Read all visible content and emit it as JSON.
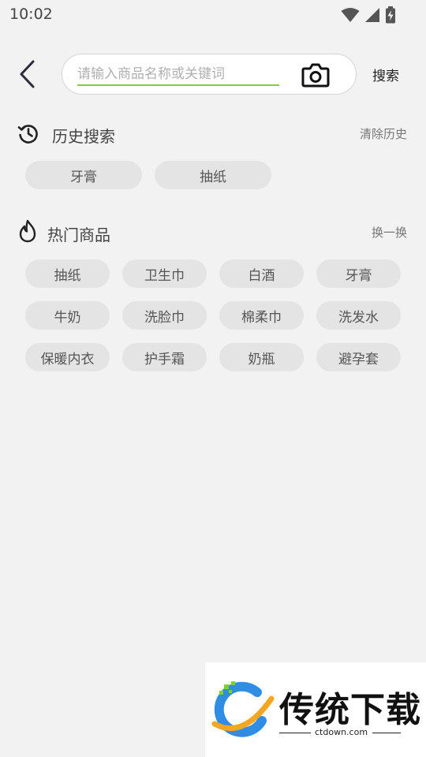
{
  "status_bar": {
    "time": "10:02",
    "icons": [
      "wifi-icon",
      "signal-icon",
      "battery-charging-icon"
    ]
  },
  "header": {
    "back_icon": "chevron-left-icon",
    "search_placeholder": "请输入商品名称或关键词",
    "search_value": "",
    "camera_icon": "camera-icon",
    "search_button": "搜索",
    "accent_color": "#8dc34a"
  },
  "history": {
    "icon": "history-icon",
    "title": "历史搜索",
    "clear_label": "清除历史",
    "items": [
      "牙膏",
      "抽纸"
    ]
  },
  "hot": {
    "icon": "flame-icon",
    "title": "热门商品",
    "refresh_label": "换一换",
    "items": [
      "抽纸",
      "卫生巾",
      "白酒",
      "牙膏",
      "牛奶",
      "洗脸巾",
      "棉柔巾",
      "洗发水",
      "保暖内衣",
      "护手霜",
      "奶瓶",
      "避孕套"
    ]
  },
  "watermark": {
    "brand": "传统下载",
    "url": "ctdown.com",
    "logo_icon": "ctdown-logo-icon"
  }
}
